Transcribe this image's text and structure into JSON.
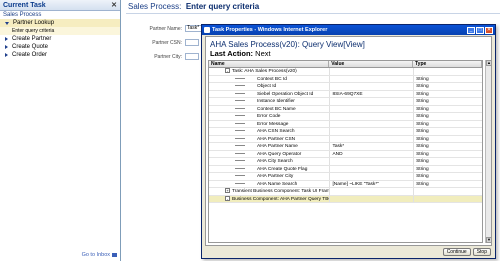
{
  "task_pane": {
    "title": "Current Task",
    "process": "Sales Process",
    "items": [
      {
        "label": "Partner Lookup",
        "expanded": true
      },
      {
        "label": "Enter query criteria",
        "sub": true
      },
      {
        "label": "Create Partner"
      },
      {
        "label": "Create Quote"
      },
      {
        "label": "Create Order"
      }
    ],
    "inbox_link": "Go to Inbox"
  },
  "main": {
    "title_prefix": "Sales Process:",
    "title_main": "Enter query criteria",
    "fields": [
      {
        "label": "Partner Name:",
        "value": "Task*"
      },
      {
        "label": "Partner CSN:",
        "value": ""
      },
      {
        "label": "Partner City:",
        "value": ""
      }
    ]
  },
  "dialog": {
    "title": "Task Properties - Windows Internet Explorer",
    "heading": "AHA Sales Process(v20): Query View[View]",
    "last_action_label": "Last Action:",
    "last_action_value": "Next",
    "columns": [
      "Name",
      "Value",
      "Type"
    ],
    "rows": [
      {
        "name": "Task: AHA Sales Process(v20)",
        "value": "",
        "type": "",
        "level": 0,
        "box": "-"
      },
      {
        "name": "Context BC Id",
        "value": "",
        "type": "String",
        "level": 1
      },
      {
        "name": "Object Id",
        "value": "",
        "type": "String",
        "level": 1
      },
      {
        "name": "Siebel Operation Object Id",
        "value": "8SIA-69Q7XE",
        "type": "String",
        "level": 1
      },
      {
        "name": "Instance Identifier",
        "value": "",
        "type": "String",
        "level": 1
      },
      {
        "name": "Context BC Name",
        "value": "",
        "type": "String",
        "level": 1
      },
      {
        "name": "Error Code",
        "value": "",
        "type": "String",
        "level": 1
      },
      {
        "name": "Error Message",
        "value": "",
        "type": "String",
        "level": 1
      },
      {
        "name": "AHA CSN Search",
        "value": "",
        "type": "String",
        "level": 1
      },
      {
        "name": "AHA Partner CSN",
        "value": "",
        "type": "String",
        "level": 1
      },
      {
        "name": "AHA Partner Name",
        "value": "Task*",
        "type": "String",
        "level": 1
      },
      {
        "name": "AHA Query Operator",
        "value": "AND",
        "type": "String",
        "level": 1
      },
      {
        "name": "AHA City Search",
        "value": "",
        "type": "String",
        "level": 1
      },
      {
        "name": "AHA Create Quote Flag",
        "value": "",
        "type": "String",
        "level": 1
      },
      {
        "name": "AHA Partner City",
        "value": "",
        "type": "String",
        "level": 1
      },
      {
        "name": "AHA Name Search",
        "value": "[Name] ~LIKE \"Task*\"",
        "type": "String",
        "level": 1
      },
      {
        "name": "Transient Business Component: Task UI Framewor",
        "value": "",
        "type": "",
        "level": 0,
        "box": "+"
      },
      {
        "name": "Business Component: AHA Partner Query TBC",
        "value": "",
        "type": "",
        "level": 0,
        "box": "-",
        "selected": true
      }
    ],
    "buttons": {
      "continue": "Continue",
      "stop": "Stop"
    }
  }
}
